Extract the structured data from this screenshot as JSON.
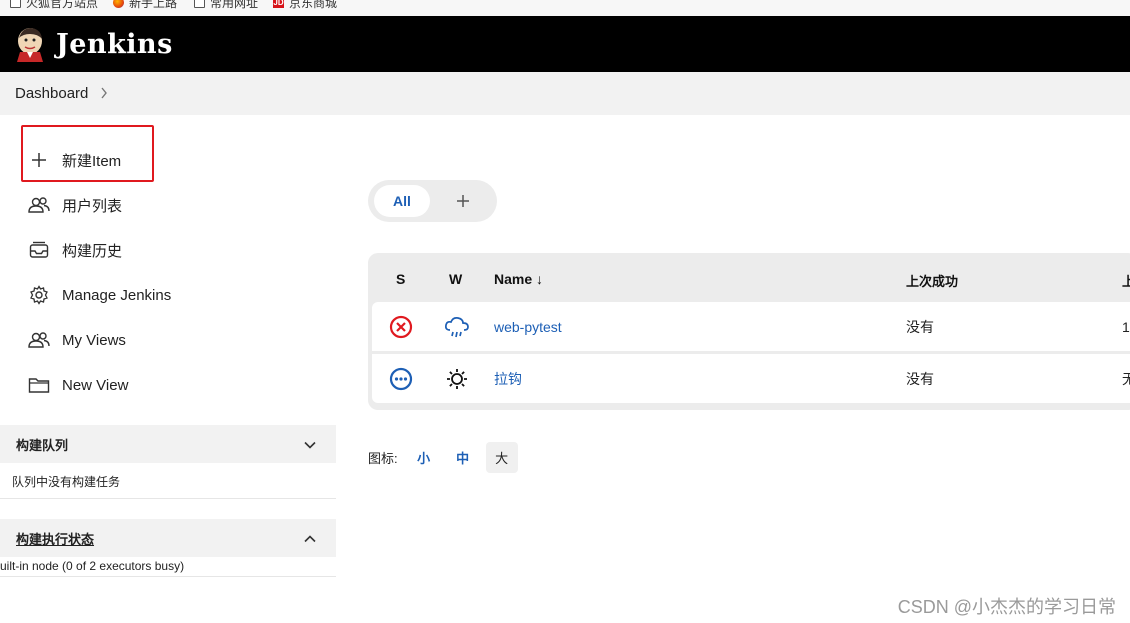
{
  "bookmarks": [
    {
      "label": "火狐官方站点",
      "icon": "folder-icon"
    },
    {
      "label": "新手上路",
      "icon": "firefox-icon"
    },
    {
      "label": "常用网址",
      "icon": "folder-icon"
    },
    {
      "label": "京东商城",
      "icon": "jd-icon"
    }
  ],
  "header": {
    "brand": "Jenkins"
  },
  "breadcrumb": {
    "item": "Dashboard"
  },
  "sidebar": {
    "items": [
      {
        "label": "新建Item",
        "icon": "plus-icon"
      },
      {
        "label": "用户列表",
        "icon": "people-icon"
      },
      {
        "label": "构建历史",
        "icon": "inbox-icon"
      },
      {
        "label": "Manage Jenkins",
        "icon": "gear-icon"
      },
      {
        "label": "My Views",
        "icon": "people-icon"
      },
      {
        "label": "New View",
        "icon": "folder-icon"
      }
    ],
    "build_queue": {
      "title": "构建队列",
      "empty_text": "队列中没有构建任务"
    },
    "executor_status": {
      "title": "构建执行状态",
      "node_text": "uilt-in node (0 of 2 executors busy)"
    }
  },
  "tabs": {
    "all_label": "All"
  },
  "table": {
    "columns": [
      "S",
      "W",
      "Name ↓",
      "上次成功",
      "上"
    ],
    "rows": [
      {
        "status": "failed",
        "weather": "rain",
        "name": "web-pytest",
        "last_success": "没有",
        "next_col": "1"
      },
      {
        "status": "not-built",
        "weather": "sunny",
        "name": "拉钩",
        "last_success": "没有",
        "next_col": "无"
      }
    ]
  },
  "icon_size": {
    "label": "图标:",
    "options": [
      "小",
      "中",
      "大"
    ],
    "selected": "大"
  },
  "watermark": "CSDN @小杰杰的学习日常",
  "colors": {
    "link": "#1d5fb5",
    "failed": "#e0191f",
    "header": "#000000",
    "highlight": "#e0191f"
  }
}
